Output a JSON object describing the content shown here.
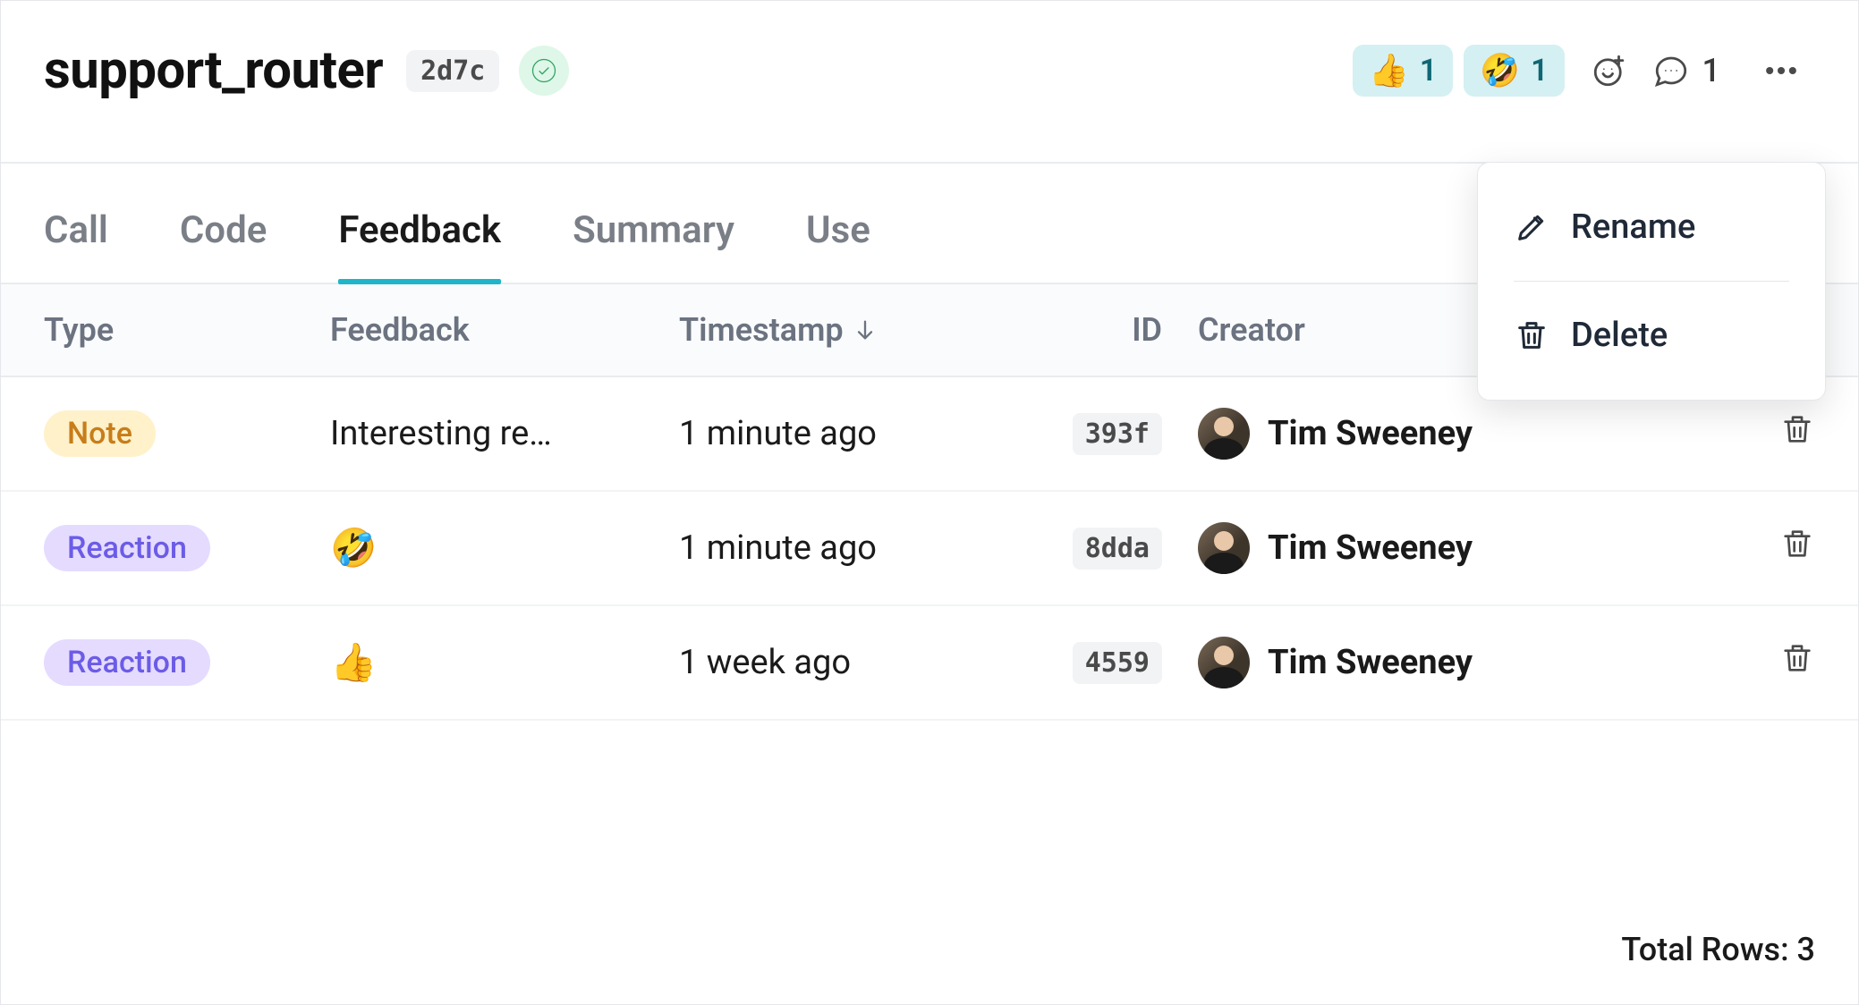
{
  "header": {
    "title": "support_router",
    "hash": "2d7c",
    "status": "success",
    "reactions": [
      {
        "emoji": "👍",
        "count": 1
      },
      {
        "emoji": "🤣",
        "count": 1
      }
    ],
    "comment_count": 1
  },
  "dropdown": {
    "rename": "Rename",
    "delete": "Delete"
  },
  "tabs": [
    {
      "label": "Call",
      "active": false
    },
    {
      "label": "Code",
      "active": false
    },
    {
      "label": "Feedback",
      "active": true
    },
    {
      "label": "Summary",
      "active": false
    },
    {
      "label": "Use",
      "active": false
    }
  ],
  "table": {
    "headers": {
      "type": "Type",
      "feedback": "Feedback",
      "timestamp": "Timestamp",
      "id": "ID",
      "creator": "Creator"
    },
    "sort": {
      "column": "timestamp",
      "direction": "desc"
    },
    "rows": [
      {
        "type_label": "Note",
        "type_kind": "note",
        "feedback_text": "Interesting re…",
        "feedback_emoji": "",
        "timestamp": "1 minute ago",
        "id": "393f",
        "creator_name": "Tim Sweeney"
      },
      {
        "type_label": "Reaction",
        "type_kind": "reaction",
        "feedback_text": "",
        "feedback_emoji": "🤣",
        "timestamp": "1 minute ago",
        "id": "8dda",
        "creator_name": "Tim Sweeney"
      },
      {
        "type_label": "Reaction",
        "type_kind": "reaction",
        "feedback_text": "",
        "feedback_emoji": "👍",
        "timestamp": "1 week ago",
        "id": "4559",
        "creator_name": "Tim Sweeney"
      }
    ]
  },
  "footer": {
    "total_label": "Total Rows:",
    "total_value": 3
  }
}
